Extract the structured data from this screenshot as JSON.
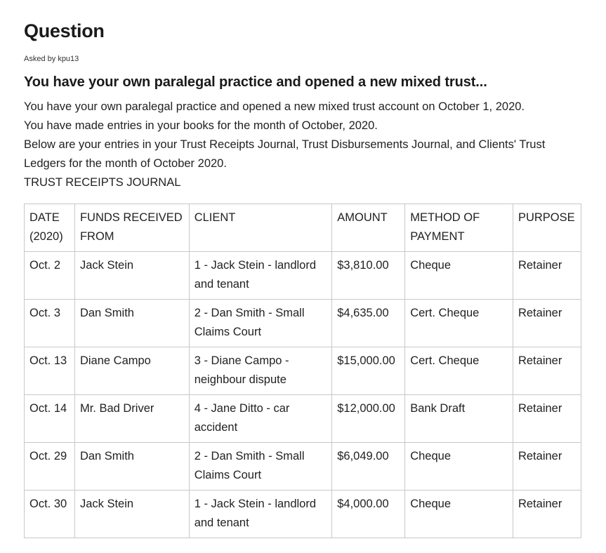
{
  "page": {
    "heading": "Question",
    "asked_prefix": "Asked by",
    "asked_user": "kpu13"
  },
  "question": {
    "title": "You have your own paralegal practice and opened a new mixed trust...",
    "paragraphs": [
      "You have your own paralegal practice and opened a new mixed trust account on October 1, 2020.",
      "You have made entries in your books for the month of October, 2020.",
      "Below are your entries in your Trust Receipts Journal, Trust Disbursements Journal, and Clients' Trust Ledgers for the month of October 2020.",
      "TRUST RECEIPTS JOURNAL"
    ]
  },
  "table": {
    "headers": [
      "DATE (2020)",
      "FUNDS RECEIVED FROM",
      "CLIENT",
      "AMOUNT",
      "METHOD OF PAYMENT",
      "PURPOSE"
    ],
    "rows": [
      [
        "Oct. 2",
        "Jack Stein",
        "1 - Jack Stein - landlord and tenant",
        "$3,810.00",
        "Cheque",
        "Retainer"
      ],
      [
        "Oct. 3",
        "Dan Smith",
        "2 - Dan Smith - Small Claims Court",
        "$4,635.00",
        "Cert. Cheque",
        "Retainer"
      ],
      [
        "Oct. 13",
        "Diane Campo",
        "3 - Diane Campo - neighbour dispute",
        "$15,000.00",
        "Cert. Cheque",
        "Retainer"
      ],
      [
        "Oct. 14",
        "Mr. Bad Driver",
        "4 - Jane Ditto - car accident",
        "$12,000.00",
        "Bank Draft",
        "Retainer"
      ],
      [
        "Oct. 29",
        "Dan Smith",
        "2 - Dan Smith - Small Claims Court",
        "$6,049.00",
        "Cheque",
        "Retainer"
      ],
      [
        "Oct. 30",
        "Jack Stein",
        "1 - Jack Stein - landlord and tenant",
        "$4,000.00",
        "Cheque",
        "Retainer"
      ]
    ]
  }
}
